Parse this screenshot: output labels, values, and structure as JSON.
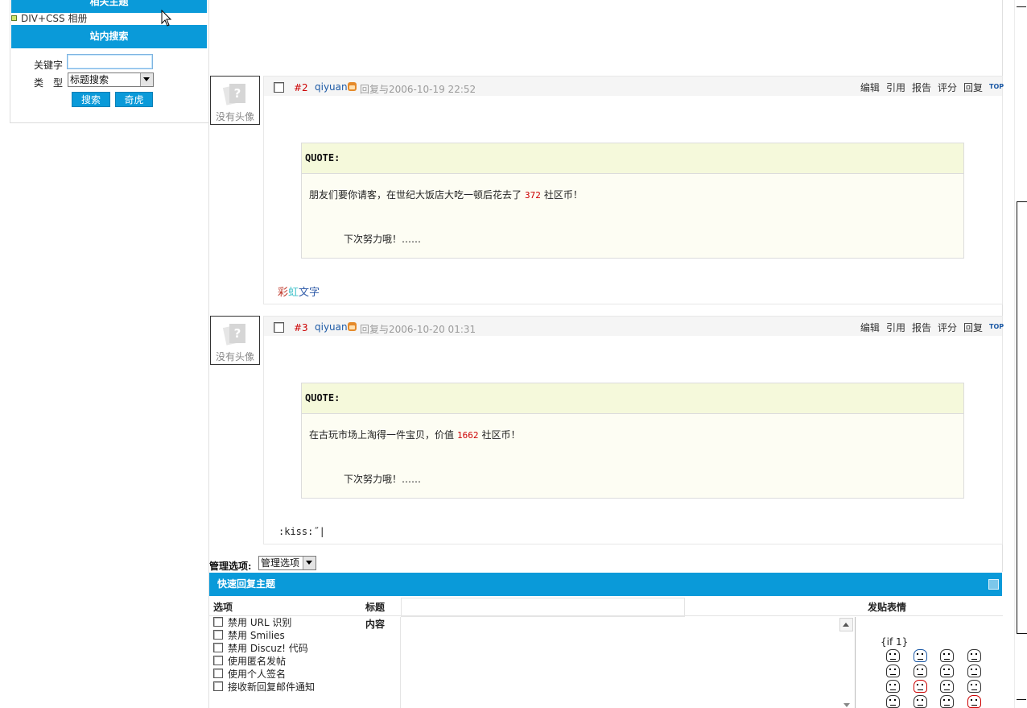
{
  "sidebar": {
    "top_header": "相关主题",
    "album_link": "DIV+CSS 相册",
    "search_header": "站内搜索",
    "keyword_label": "关键字",
    "keyword_value": "",
    "type_label": "类　型",
    "type_selected": "标题搜索",
    "search_button": "搜索",
    "qihu_button": "奇虎"
  },
  "posts": [
    {
      "number": "#2",
      "author": "qiyuan",
      "meta": "回复与2006-10-19 22:52",
      "avatar_caption": "没有头像",
      "actions": [
        "编辑",
        "引用",
        "报告",
        "评分",
        "回复"
      ],
      "quote_header": "QUOTE:",
      "quote_before": "朋友们要你请客，在世纪大饭店大吃一顿后花去了",
      "quote_number": "372",
      "quote_after": "社区币！",
      "quote_line2": "下次努力哦！……",
      "signature_chars": [
        "彩",
        "虹",
        "文",
        "字"
      ]
    },
    {
      "number": "#3",
      "author": "qiyuan",
      "meta": "回复与2006-10-20 01:31",
      "avatar_caption": "没有头像",
      "actions": [
        "编辑",
        "引用",
        "报告",
        "评分",
        "回复"
      ],
      "quote_header": "QUOTE:",
      "quote_before": "在古玩市场上淘得一件宝贝，价值",
      "quote_number": "1662",
      "quote_after": "社区币！",
      "quote_line2": "下次努力哦！……",
      "message": ":kiss:˝|"
    }
  ],
  "top_icon_label": "TOP",
  "manage": {
    "label": "管理选项:",
    "select_value": "管理选项"
  },
  "quick_reply": {
    "title": "快速回复主题",
    "col_options": "选项",
    "col_subject": "标题",
    "col_content": "内容",
    "col_smilies": "发贴表情",
    "subject_value": "",
    "message_value": "",
    "options": [
      "禁用 URL 识别",
      "禁用 Smilies",
      "禁用 Discuz! 代码",
      "使用匿名发帖",
      "使用个人签名",
      "接收新回复邮件通知"
    ],
    "smilies_label": "{if 1}"
  },
  "colors": {
    "accent": "#0a9ad9",
    "post_number": "#cc0000",
    "author": "#1d5aa6",
    "quote_header_bg": "#f5f9db",
    "quote_body_bg": "#fdfdf3",
    "rainbow": [
      "#c0392b",
      "#3fc1c9",
      "#2e5aa8",
      "#2e5aa8"
    ]
  }
}
